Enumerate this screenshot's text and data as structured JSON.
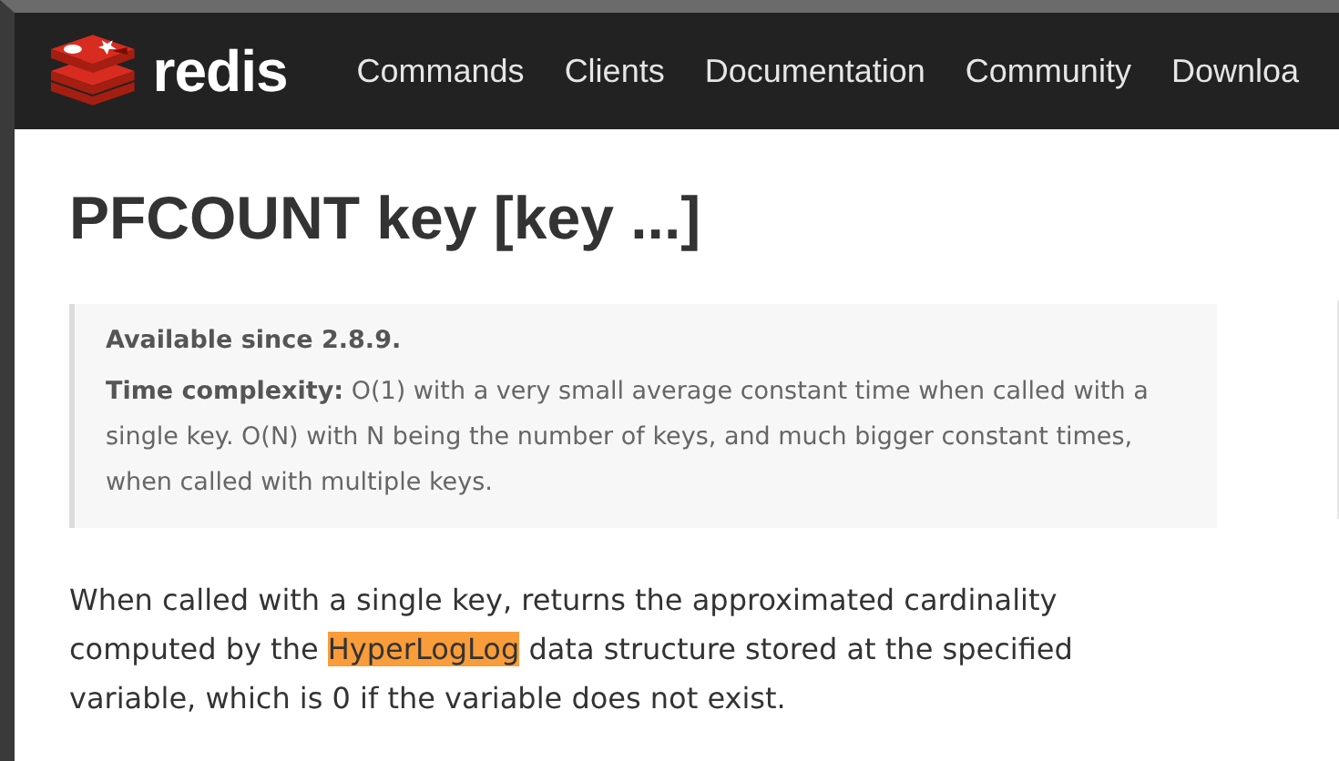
{
  "navbar": {
    "brand": "redis",
    "links": [
      "Commands",
      "Clients",
      "Documentation",
      "Community",
      "Downloa"
    ]
  },
  "title": "PFCOUNT key [key ...]",
  "info": {
    "since": "Available since 2.8.9.",
    "complexity_label": "Time complexity:",
    "complexity_text": "O(1) with a very small average constant time when called with a single key. O(N) with N being the number of keys, and much bigger constant times, when called with multiple keys."
  },
  "paragraph": {
    "before": "When called with a single key, returns the approximated cardinality computed by the ",
    "highlight": "HyperLogLog",
    "after": " data structure stored at the specified variable, which is 0 if the variable does not exist."
  }
}
